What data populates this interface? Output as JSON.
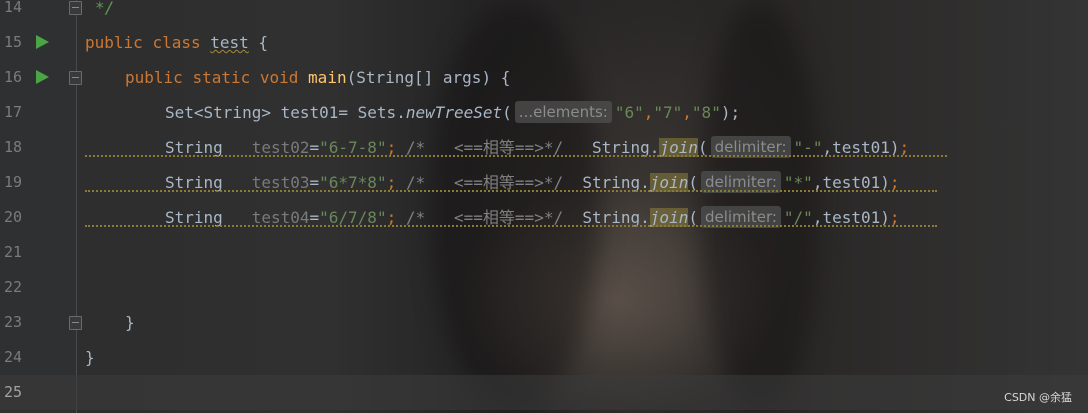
{
  "editor": {
    "lines": [
      {
        "num": "14",
        "a": "*/"
      },
      {
        "num": "15",
        "kw1": "public",
        "kw2": "class",
        "name": "test",
        "brace": " {"
      },
      {
        "num": "16",
        "kw1": "public",
        "kw2": "static",
        "kw3": "void",
        "fn": "main",
        "rest": "(String[] args) {"
      },
      {
        "num": "17",
        "pre": "Set<String> test01= Sets.",
        "fn": "newTreeSet",
        "open": "(",
        "hint": "...elements:",
        "s1": "\"6\"",
        "s2": "\"7\"",
        "s3": "\"8\"",
        "end": ");"
      },
      {
        "num": "18",
        "t": "String",
        "v": "test02",
        "eq": "=",
        "s": "\"6-7-8\"",
        "semi": ";",
        "cm": "/*   <==相等==>*/",
        "call": "String.",
        "fn": "join",
        "open": "(",
        "hint": "delimiter:",
        "d": "\"-\"",
        "arg": ",test01)",
        "semi2": ";"
      },
      {
        "num": "19",
        "t": "String",
        "v": "test03",
        "eq": "=",
        "s": "\"6*7*8\"",
        "semi": ";",
        "cm": "/*   <==相等==>*/",
        "call": "String.",
        "fn": "join",
        "open": "(",
        "hint": "delimiter:",
        "d": "\"*\"",
        "arg": ",test01)",
        "semi2": ";"
      },
      {
        "num": "20",
        "t": "String",
        "v": "test04",
        "eq": "=",
        "s": "\"6/7/8\"",
        "semi": ";",
        "cm": "/*   <==相等==>*/",
        "call": "String.",
        "fn": "join",
        "open": "(",
        "hint": "delimiter:",
        "d": "\"/\"",
        "arg": ",test01)",
        "semi2": ";"
      },
      {
        "num": "21"
      },
      {
        "num": "22"
      },
      {
        "num": "23",
        "a": "}"
      },
      {
        "num": "24",
        "a": "}"
      },
      {
        "num": "25"
      }
    ]
  },
  "watermark": "CSDN @余猛",
  "colors": {
    "keyword": "#cc7832",
    "string": "#6a8759",
    "method": "#ffc66d",
    "comment": "#808080",
    "run_icon": "#4ca544"
  },
  "icons": {
    "run": "run-gutter-icon",
    "fold": "fold-marker-icon"
  }
}
